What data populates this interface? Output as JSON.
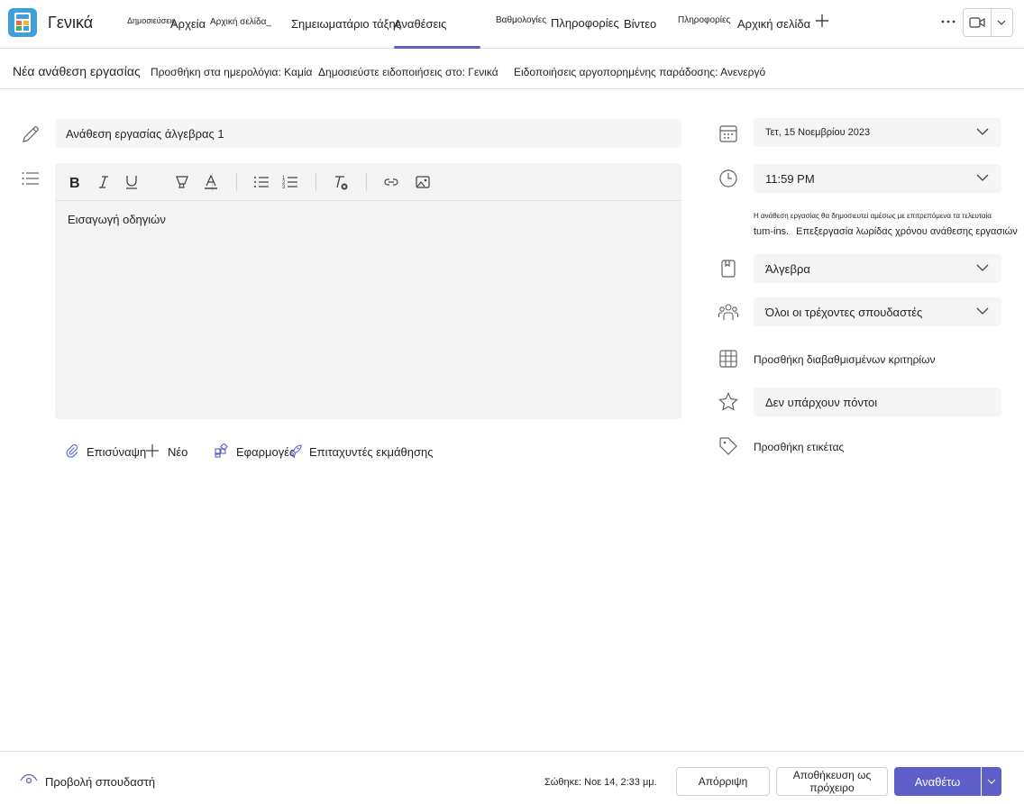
{
  "header": {
    "channel_title": "Γενικά",
    "tabs": [
      {
        "label": "Δημοσιεύσεις"
      },
      {
        "label": "Αρχεία"
      },
      {
        "label": "Αρχική σελίδα_"
      },
      {
        "label": "Σημειωματάριο τάξης"
      },
      {
        "label": "Αναθέσεις"
      },
      {
        "label": "Βαθμολογίες"
      },
      {
        "label": "Πληροφορίες"
      },
      {
        "label": "Βίντεο"
      },
      {
        "label": "Πληροφορίες"
      },
      {
        "label": "Αρχική σελίδα"
      }
    ],
    "active_tab": "Αναθέσεις"
  },
  "subheader": {
    "title": "Νέα ανάθεση εργασίας",
    "calendar": "Προσθήκη στα ημερολόγια: Καμία",
    "notify": "Δημοσιεύστε ειδοποιήσεις στο: Γενικά",
    "late": "Ειδοποιήσεις αργοπορημένης παράδοσης: Ανενεργό"
  },
  "form": {
    "title_value": "Ανάθεση εργασίας άλγεβρας 1",
    "instructions_placeholder": "Εισαγωγή οδηγιών",
    "attach_label": "Επισύναψη",
    "new_label": "Νέο",
    "apps_label": "Εφαρμογές",
    "accelerators_label": "Επιταχυντές εκμάθησης"
  },
  "settings": {
    "due_date": "Τετ, 15 Νοεμβρίου 2023",
    "due_time": "11:59 PM",
    "note_small": "Η ανάθεση εργασίας θα δημοσιευτεί αμέσως με επιτρεπόμενα τα τελευταία",
    "note_prefix": "tum-ins.",
    "note_link": "Επεξεργασία λωρίδας χρόνου ανάθεσης εργασιών",
    "category": "Άλγεβρα",
    "students": "Όλοι οι τρέχοντες σπουδαστές",
    "rubric": "Προσθήκη διαβαθμισμένων κριτηρίων",
    "points": "Δεν υπάρχουν πόντοι",
    "tag": "Προσθήκη ετικέτας"
  },
  "footer": {
    "preview": "Προβολή σπουδαστή",
    "saved": "Σώθηκε: Νοε 14, 2:33 μμ.",
    "discard": "Απόρριψη",
    "save_draft": "Αποθήκευση ως πρόχειρο",
    "assign": "Αναθέτω"
  },
  "colors": {
    "accent": "#5b5fc7",
    "app_icon": "#3f9fd8"
  }
}
